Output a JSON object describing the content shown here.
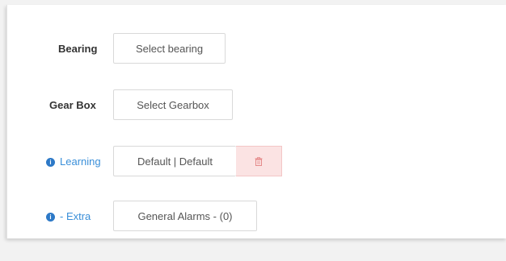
{
  "form": {
    "bearing": {
      "label": "Bearing",
      "button": "Select bearing"
    },
    "gearbox": {
      "label": "Gear Box",
      "button": "Select Gearbox"
    },
    "learning": {
      "label": "Learning",
      "button": "Default | Default"
    },
    "extra": {
      "label": "- Extra",
      "button": "General Alarms - (0)"
    }
  },
  "colors": {
    "info_icon": "#2d79c7",
    "info_label": "#3a8fd9",
    "delete_bg": "#fbe3e3",
    "delete_icon": "#e58a8a"
  },
  "icons": {
    "info": "info-circle-icon",
    "delete": "trash-icon"
  }
}
